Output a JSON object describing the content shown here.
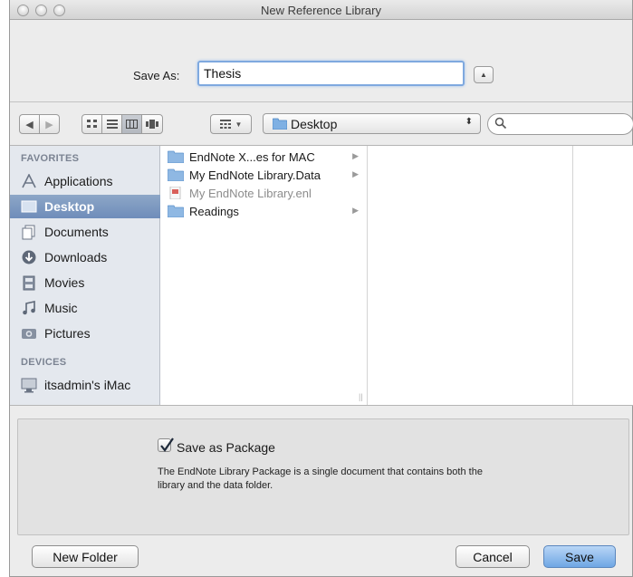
{
  "window": {
    "title": "New Reference Library"
  },
  "save": {
    "label": "Save As:",
    "filename": "Thesis"
  },
  "toolbar": {
    "location": "Desktop",
    "search_placeholder": ""
  },
  "sidebar": {
    "favorites_heading": "FAVORITES",
    "favorites": [
      {
        "label": "Applications",
        "icon": "applications-icon",
        "selected": false
      },
      {
        "label": "Desktop",
        "icon": "desktop-icon",
        "selected": true
      },
      {
        "label": "Documents",
        "icon": "documents-icon",
        "selected": false
      },
      {
        "label": "Downloads",
        "icon": "downloads-icon",
        "selected": false
      },
      {
        "label": "Movies",
        "icon": "movies-icon",
        "selected": false
      },
      {
        "label": "Music",
        "icon": "music-icon",
        "selected": false
      },
      {
        "label": "Pictures",
        "icon": "pictures-icon",
        "selected": false
      }
    ],
    "devices_heading": "DEVICES",
    "devices": [
      {
        "label": "itsadmin's iMac",
        "icon": "imac-icon"
      }
    ]
  },
  "files": [
    {
      "name": "EndNote X...es for MAC",
      "type": "folder",
      "has_children": true,
      "dimmed": false
    },
    {
      "name": "My EndNote Library.Data",
      "type": "folder",
      "has_children": true,
      "dimmed": false
    },
    {
      "name": "My EndNote Library.enl",
      "type": "enl-file",
      "has_children": false,
      "dimmed": true
    },
    {
      "name": "Readings",
      "type": "folder",
      "has_children": true,
      "dimmed": false
    }
  ],
  "package": {
    "checked": true,
    "label": "Save as Package",
    "description": "The EndNote Library Package is a single document that contains both the library and the data folder."
  },
  "buttons": {
    "new_folder": "New Folder",
    "cancel": "Cancel",
    "save": "Save"
  },
  "colors": {
    "selection": "#7592bd",
    "sidebar_bg": "#e4e8ee",
    "folder": "#8fb8e3",
    "primary_button": "#8cbbed"
  }
}
